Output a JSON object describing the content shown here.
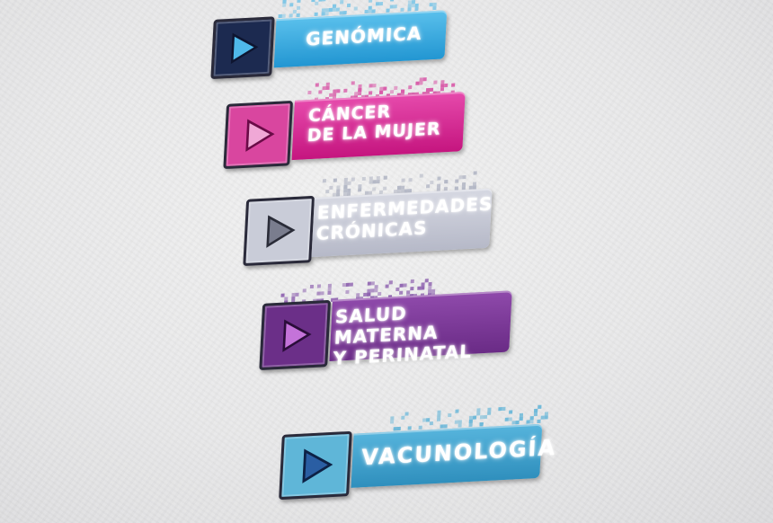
{
  "badges": [
    {
      "label": "GENÓMICA",
      "bar_color": "#2aa0d8",
      "box_color": "#1c2a50",
      "arrow_color": "#4fb9ea",
      "pixel_color": "#7fc6e6"
    },
    {
      "label": "CÁNCER\nDE LA MUJER",
      "bar_color": "#d21f93",
      "box_color": "#d9469f",
      "arrow_color": "#e892c9",
      "pixel_color": "#d85aa8"
    },
    {
      "label": "ENFERMEDADES\nCRÓNICAS",
      "bar_color": "#c3c6d3",
      "box_color": "#c9ccd8",
      "arrow_color": "#6f7284",
      "pixel_color": "#b4b8c6"
    },
    {
      "label": "SALUD MATERNA\nY PERINATAL",
      "bar_color": "#7a3a94",
      "box_color": "#6b2f88",
      "arrow_color": "#c473d9",
      "pixel_color": "#8f64b0"
    },
    {
      "label": "VACUNOLOGÍA",
      "bar_color": "#3a9fc7",
      "box_color": "#5fb6d8",
      "arrow_color": "#1f4e8f",
      "pixel_color": "#6fb9d9"
    }
  ]
}
